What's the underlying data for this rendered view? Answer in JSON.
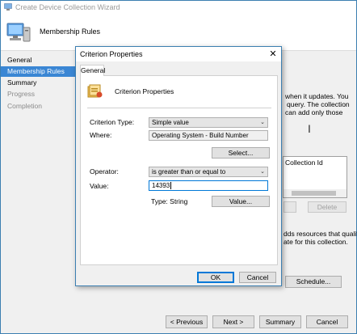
{
  "wizard": {
    "title": "Create Device Collection Wizard",
    "header": "Membership Rules",
    "nav": [
      {
        "label": "General",
        "state": "normal"
      },
      {
        "label": "Membership Rules",
        "state": "active"
      },
      {
        "label": "Summary",
        "state": "normal"
      },
      {
        "label": "Progress",
        "state": "disabled"
      },
      {
        "label": "Completion",
        "state": "disabled"
      }
    ],
    "background_text": {
      "line1": "when it updates. You",
      "line2": "query. The collection",
      "line3": "can add only those",
      "list_header": "Collection Id",
      "line4": "dds resources that qualify",
      "line5": "ate for this collection."
    },
    "buttons": {
      "delete": "Delete",
      "schedule": "Schedule...",
      "previous": "< Previous",
      "next": "Next >",
      "summary": "Summary",
      "cancel": "Cancel"
    }
  },
  "dialog": {
    "title": "Criterion Properties",
    "close_glyph": "✕",
    "tab": "General",
    "heading": "Criterion Properties",
    "criterion_type_label": "Criterion Type:",
    "criterion_type_value": "Simple value",
    "where_label": "Where:",
    "where_value": "Operating System - Build Number",
    "select_button": "Select...",
    "operator_label": "Operator:",
    "operator_value": "is greater than or equal to",
    "value_label": "Value:",
    "value_value": "14393",
    "type_text": "Type: String",
    "value_button": "Value...",
    "ok": "OK",
    "cancel": "Cancel"
  },
  "icons": {
    "wizard_title": "computer-icon",
    "wizard_header": "computer-icon",
    "panel": "criterion-icon",
    "combo_arrow": "chevron-down-icon"
  },
  "colors": {
    "accent": "#3a86d4",
    "window_border": "#3c7fb1",
    "focus": "#0078d7"
  }
}
